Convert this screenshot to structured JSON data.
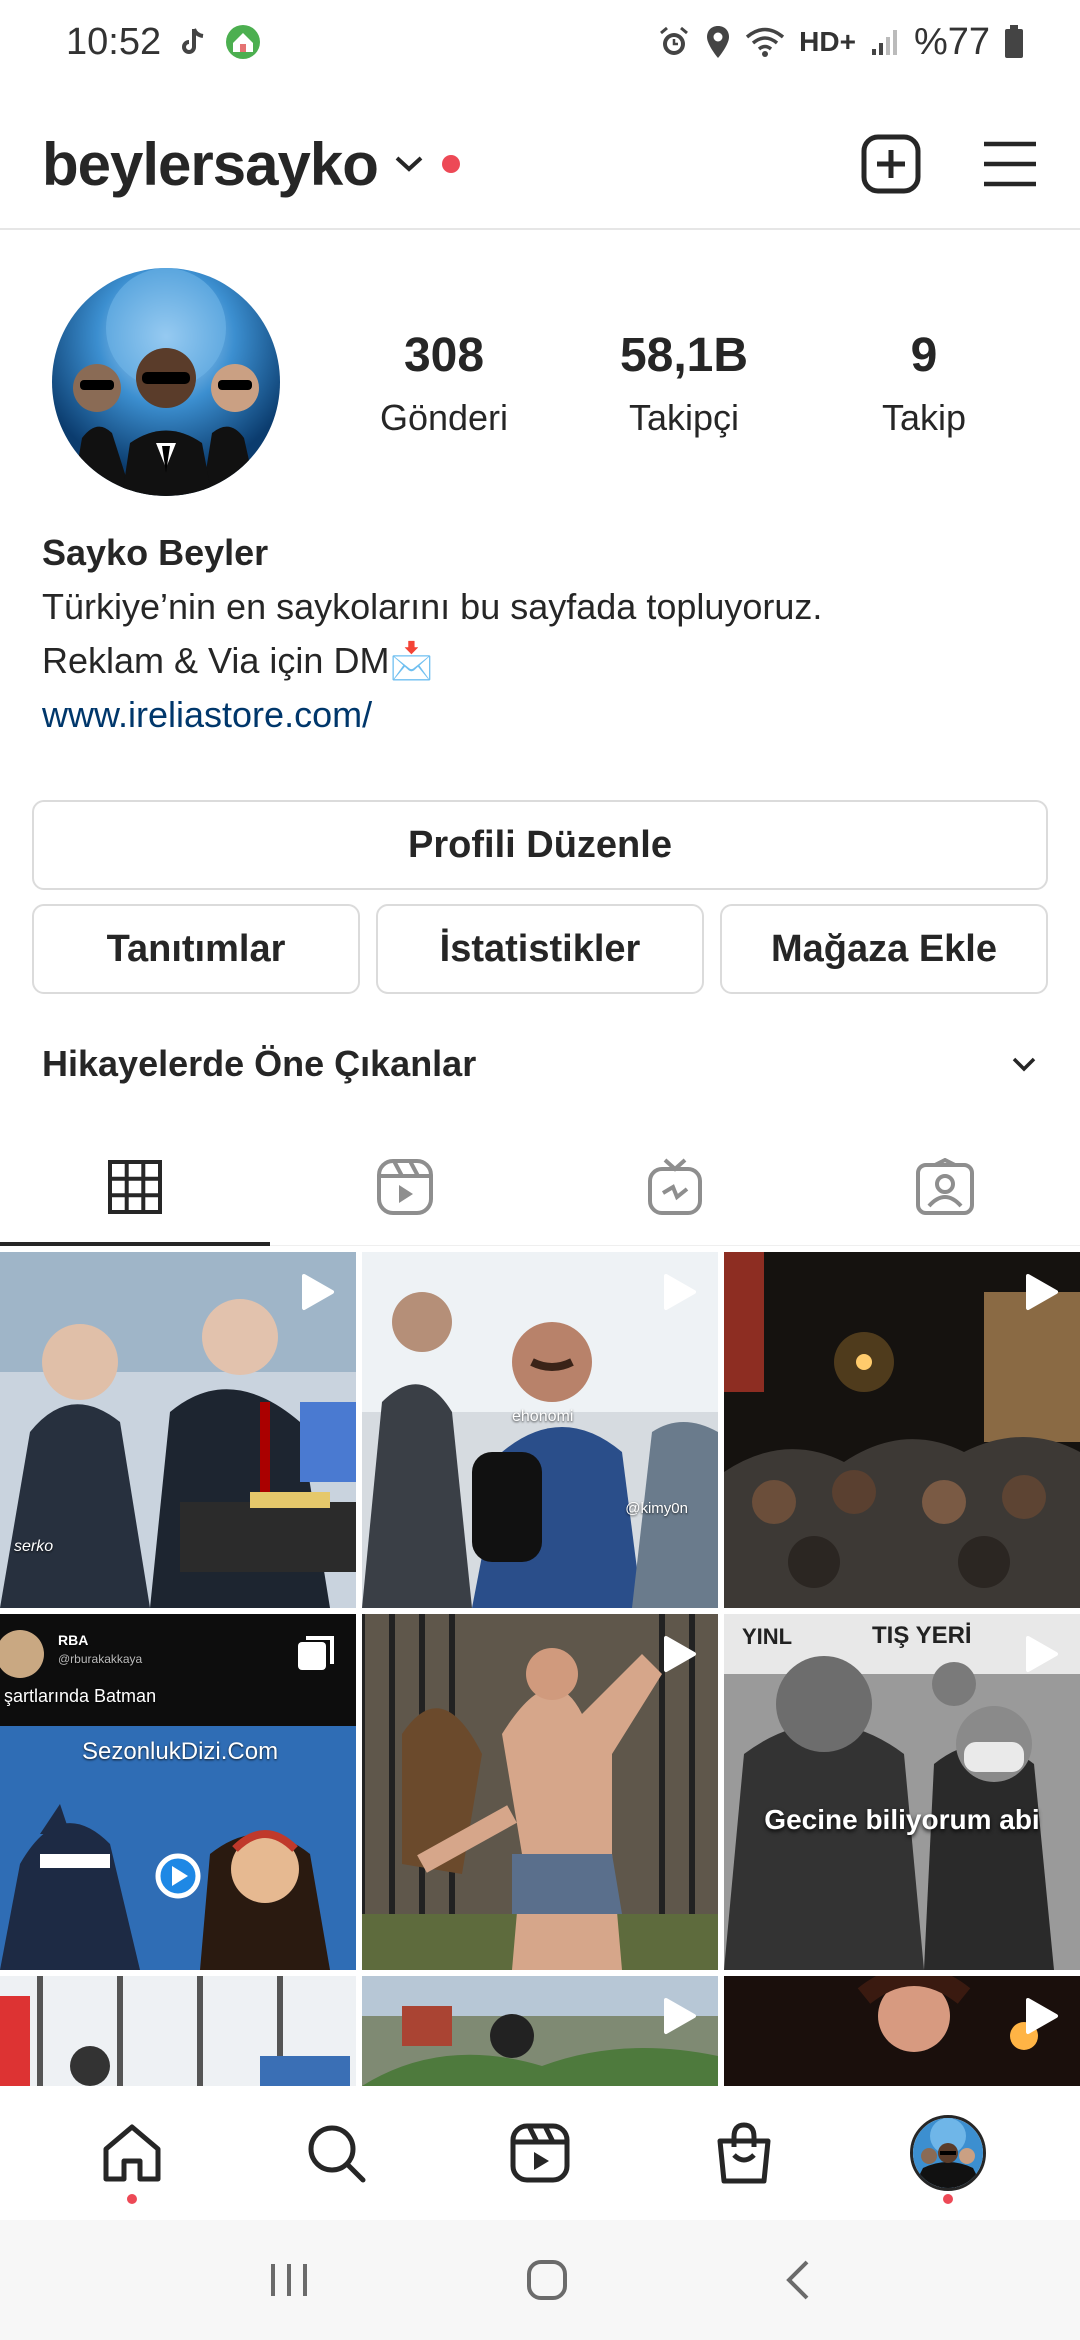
{
  "status_bar": {
    "time": "10:52",
    "network": "HD+",
    "battery": "%77"
  },
  "header": {
    "username": "beylersayko"
  },
  "profile": {
    "stats": [
      {
        "value": "308",
        "label": "Gönderi"
      },
      {
        "value": "58,1B",
        "label": "Takipçi"
      },
      {
        "value": "9",
        "label": "Takip"
      }
    ],
    "name": "Sayko Beyler",
    "bio_lines": [
      "Türkiye’nin en saykolarını bu sayfada topluyoruz.",
      "Reklam & Via için DM📩"
    ],
    "link": "www.ireliastore.com/"
  },
  "buttons": {
    "edit_profile": "Profili Düzenle",
    "promotions": "Tanıtımlar",
    "insights": "İstatistikler",
    "add_shop": "Mağaza Ekle"
  },
  "highlights": {
    "title": "Hikayelerde Öne Çıkanlar"
  },
  "tabs": [
    "grid",
    "reels",
    "igtv",
    "tagged"
  ],
  "grid_posts": [
    {
      "type": "reel",
      "captions": [
        "serko"
      ]
    },
    {
      "type": "reel",
      "captions": [
        "ehonomi",
        "@kimy0n"
      ]
    },
    {
      "type": "reel",
      "captions": []
    },
    {
      "type": "carousel",
      "captions": [
        "RBA",
        "@rburakakkaya",
        "şartlarında Batman",
        "SezonlukDizi.Com"
      ]
    },
    {
      "type": "reel",
      "captions": []
    },
    {
      "type": "reel",
      "captions": [
        "YINL",
        "TIŞ YERİ",
        "Gecine biliyorum abi"
      ]
    },
    {
      "type": "photo",
      "captions": []
    },
    {
      "type": "reel",
      "captions": []
    },
    {
      "type": "reel",
      "captions": []
    }
  ],
  "colors": {
    "accent_dot": "#ed4956",
    "link": "#00376b",
    "text": "#262626"
  }
}
